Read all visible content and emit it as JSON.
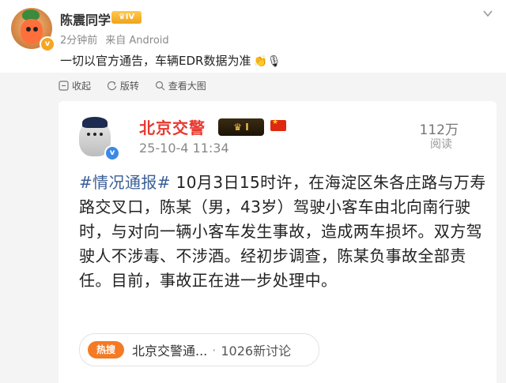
{
  "post": {
    "author": "陈震同学",
    "level_badge": "IV",
    "time_ago": "2分钟前",
    "source": "来自 Android",
    "text": "一切以官方通告，车辆EDR数据为准",
    "emojis": "👏🎙"
  },
  "toolbar": {
    "collapse": "收起",
    "repost": "版转",
    "view_large": "查看大图"
  },
  "card": {
    "name": "北京交警",
    "badge": "I",
    "timestamp": "25-10-4 11:34",
    "read_count": "112万",
    "read_label": "阅读",
    "hashtag": "#情况通报#",
    "body": " 10月3日15时许，在海淀区朱各庄路与万寿路交叉口，陈某（男，43岁）驾驶小客车由北向南行驶时，与对向一辆小客车发生事故，造成两车损坏。双方驾驶人不涉毒、不涉酒。经初步调查，陈某负事故全部责任。目前，事故正在进一步处理中。",
    "topic": {
      "hot_label": "热搜",
      "name": "北京交警通...",
      "separator": "·",
      "discussion": "1026新讨论"
    }
  },
  "colors": {
    "card_name": "#e8382f",
    "hashtag": "#3a5f97",
    "hot": "#f47a24",
    "background": "#f4f4f4"
  }
}
